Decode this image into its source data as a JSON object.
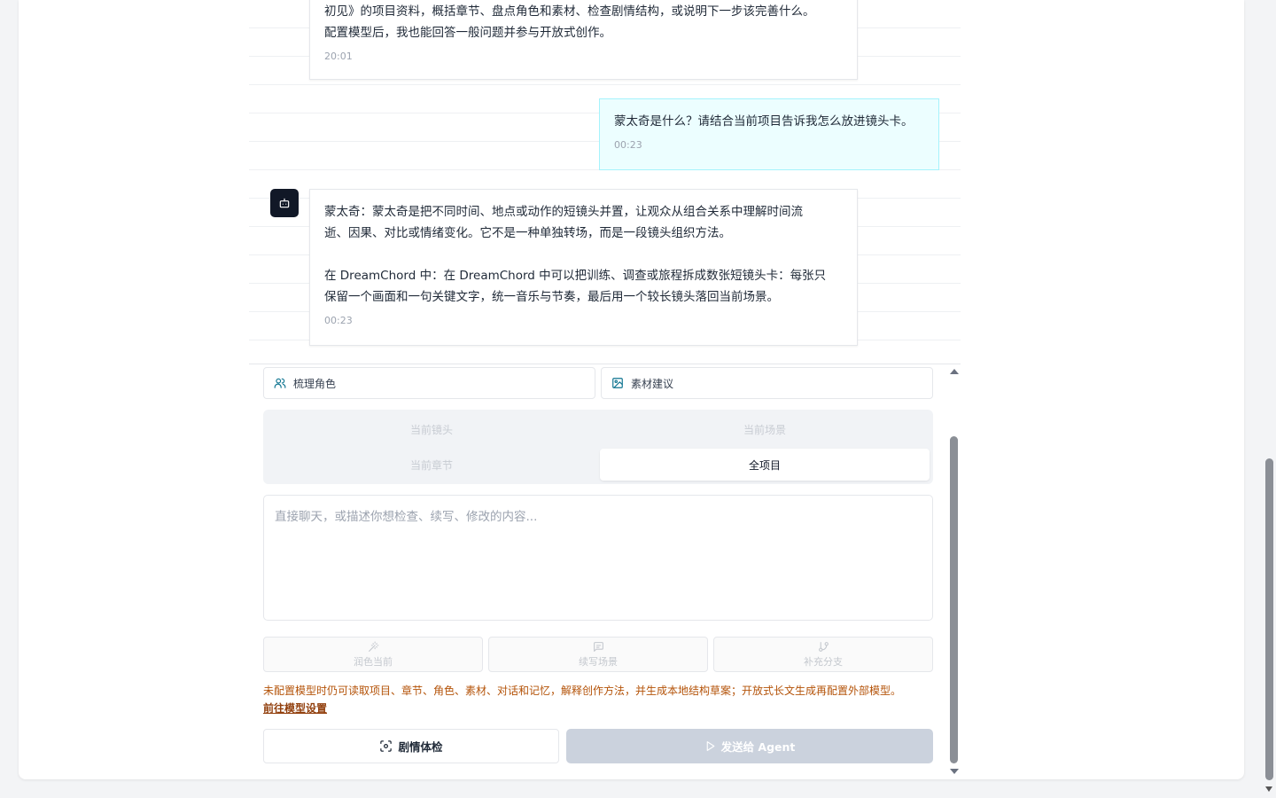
{
  "chat": {
    "messages": [
      {
        "role": "assistant",
        "lines": [
          "初见》的项目资料，概括章节、盘点角色和素材、检查剧情结构，或说明下一步该完善什么。",
          "配置模型后，我也能回答一般问题并参与开放式创作。"
        ],
        "time": "20:01"
      },
      {
        "role": "user",
        "text": "蒙太奇是什么？请结合当前项目告诉我怎么放进镜头卡。",
        "time": "00:23"
      },
      {
        "role": "assistant",
        "para1_lines": [
          "蒙太奇：蒙太奇是把不同时间、地点或动作的短镜头并置，让观众从组合关系中理解时间流",
          "逝、因果、对比或情绪变化。它不是一种单独转场，而是一段镜头组织方法。"
        ],
        "para2_lines": [
          "在 DreamChord 中：在 DreamChord 中可以把训练、调查或旅程拆成数张短镜头卡：每张只",
          "保留一个画面和一句关键文字，统一音乐与节奏，最后用一个较长镜头落回当前场景。"
        ],
        "time": "00:23"
      }
    ]
  },
  "quick_actions": {
    "characters": "梳理角色",
    "assets": "素材建议"
  },
  "scope": {
    "current_shot": "当前镜头",
    "current_scene": "当前场景",
    "current_chapter": "当前章节",
    "whole_project": "全项目",
    "selected": "全项目"
  },
  "composer": {
    "placeholder": "直接聊天，或描述你想检查、续写、修改的内容...",
    "value": ""
  },
  "tools": {
    "polish": "润色当前",
    "continue": "续写场景",
    "branch": "补充分支"
  },
  "notice": {
    "text": "未配置模型时仍可读取项目、章节、角色、素材、对话和记忆，解释创作方法，并生成本地结构草案；开放式长文生成再配置外部模型。",
    "link": "前往模型设置"
  },
  "actions": {
    "health_check": "剧情体检",
    "send": "发送给 Agent"
  },
  "colors": {
    "user_bubble_bg": "#ecfeff",
    "user_bubble_border": "#a5f3fc",
    "notice": "#b45309",
    "send_disabled": "#cbd2dd"
  },
  "icons": {
    "avatar": "bot-icon",
    "characters": "users-icon",
    "assets": "image-icon",
    "polish": "wand-icon",
    "continue": "message-square-icon",
    "branch": "git-branch-icon",
    "health": "scan-icon",
    "send": "play-icon"
  }
}
